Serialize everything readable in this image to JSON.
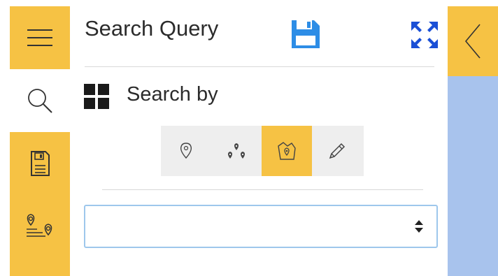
{
  "panel": {
    "title": "Search Query",
    "search_by_label": "Search by",
    "select_value": ""
  },
  "left_rail": {
    "items": [
      {
        "icon": "menu-icon",
        "active": false
      },
      {
        "icon": "search-icon",
        "active": true
      },
      {
        "icon": "saved-queries-icon",
        "active": false
      },
      {
        "icon": "route-icon",
        "active": false
      }
    ]
  },
  "search_modes": [
    {
      "icon": "point-pin-icon",
      "selected": false
    },
    {
      "icon": "multi-point-icon",
      "selected": false
    },
    {
      "icon": "area-polygon-icon",
      "selected": true
    },
    {
      "icon": "draw-pencil-icon",
      "selected": false
    }
  ],
  "colors": {
    "accent": "#f6c244",
    "map_background": "#a8c3ed",
    "save_icon": "#2d8de6",
    "expand_icon": "#1a4fd6",
    "select_border": "#9ec7ec"
  }
}
